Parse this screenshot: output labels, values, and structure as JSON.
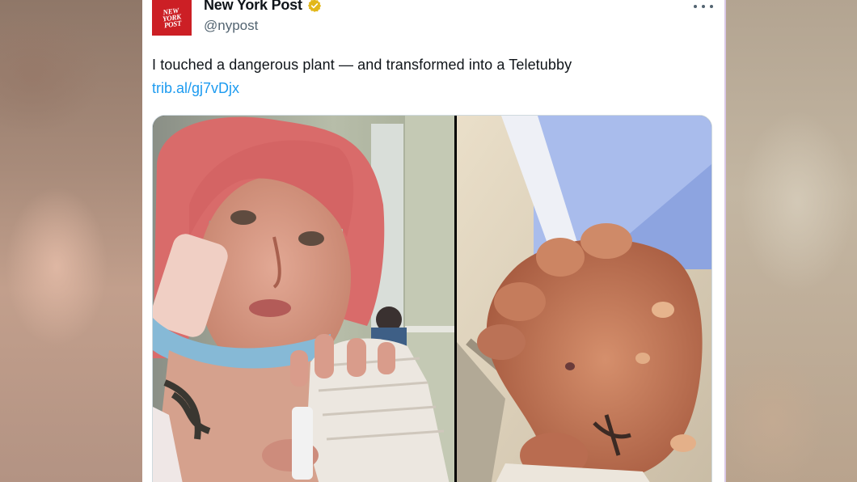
{
  "account": {
    "avatar_text": "NEW\nYORK\nPOST",
    "display_name": "New York Post",
    "handle": "@nypost",
    "verified_color": "#e2b719"
  },
  "tweet": {
    "text": "I touched a dangerous plant — and transformed into a Teletubby",
    "link": "trib.al/gj7vDjx"
  },
  "media": {
    "photos": [
      {
        "subject": "selfie-in-hospital-bandaged-hand"
      },
      {
        "subject": "blistered-swollen-hand"
      }
    ]
  },
  "colors": {
    "accent": "#1d9bf0",
    "brand_red": "#cc1f25",
    "text": "#0f1419",
    "secondary_text": "#536471"
  }
}
